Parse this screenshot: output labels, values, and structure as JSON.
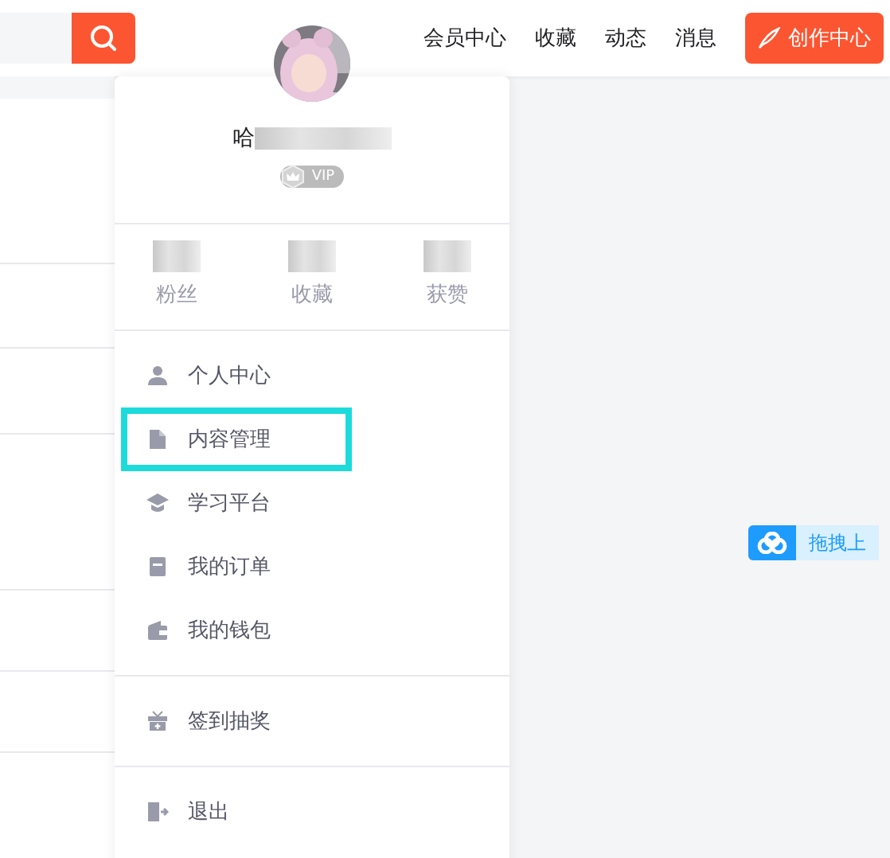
{
  "nav": [
    {
      "label": "会员中心"
    },
    {
      "label": "收藏"
    },
    {
      "label": "动态"
    },
    {
      "label": "消息"
    }
  ],
  "create_button": "创作中心",
  "profile": {
    "name": "哈",
    "vip_badge": "VIP"
  },
  "stats": [
    {
      "label": "粉丝"
    },
    {
      "label": "收藏"
    },
    {
      "label": "获赞"
    }
  ],
  "menu_groups": [
    [
      {
        "label": "个人中心",
        "kind": "person",
        "highlighted": false
      },
      {
        "label": "内容管理",
        "kind": "document",
        "highlighted": true
      },
      {
        "label": "学习平台",
        "kind": "cap",
        "highlighted": false
      },
      {
        "label": "我的订单",
        "kind": "order",
        "highlighted": false
      },
      {
        "label": "我的钱包",
        "kind": "wallet",
        "highlighted": false
      }
    ],
    [
      {
        "label": "签到抽奖",
        "kind": "gift",
        "highlighted": false
      }
    ],
    [
      {
        "label": "退出",
        "kind": "exit",
        "highlighted": false
      }
    ]
  ],
  "upload_button": "拖拽上"
}
